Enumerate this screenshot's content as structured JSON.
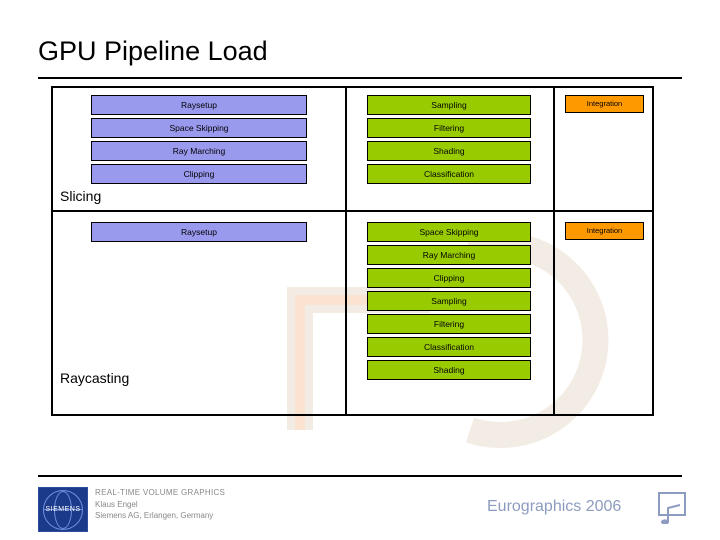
{
  "slide": {
    "title": "GPU Pipeline Load",
    "row_labels": {
      "slicing": "Slicing",
      "raycasting": "Raycasting"
    },
    "columns": [
      {
        "name": "vertex-stage"
      },
      {
        "name": "fragment-stage"
      },
      {
        "name": "output-stage"
      }
    ],
    "rows": [
      {
        "name": "slicing",
        "label": "Slicing",
        "columns": [
          {
            "name": "vertex",
            "color": "#9999ee",
            "items": [
              "Raysetup",
              "Space Skipping",
              "Ray Marching",
              "Clipping"
            ]
          },
          {
            "name": "fragment",
            "color": "#99cc00",
            "items": [
              "Sampling",
              "Filtering",
              "Shading",
              "Classification"
            ]
          },
          {
            "name": "output",
            "color": "#ff9900",
            "items": [
              "Integration"
            ]
          }
        ]
      },
      {
        "name": "raycasting",
        "label": "Raycasting",
        "columns": [
          {
            "name": "vertex",
            "color": "#9999ee",
            "items": [
              "Raysetup"
            ]
          },
          {
            "name": "fragment",
            "color": "#99cc00",
            "items": [
              "Space Skipping",
              "Ray Marching",
              "Clipping",
              "Sampling",
              "Filtering",
              "Classification",
              "Shading"
            ]
          },
          {
            "name": "output",
            "color": "#ff9900",
            "items": [
              "Integration"
            ]
          }
        ]
      }
    ]
  },
  "footer": {
    "logo_label": "SIEMENS",
    "line1": "REAL-TIME VOLUME GRAPHICS",
    "line2": "Klaus Engel",
    "line3": "Siemens AG, Erlangen, Germany",
    "conference": "Eurographics 2006"
  },
  "colors": {
    "vertex": "#9999ee",
    "fragment": "#99cc00",
    "output": "#ff9900",
    "rule": "#000000",
    "conference_text": "#8c9bbf"
  }
}
